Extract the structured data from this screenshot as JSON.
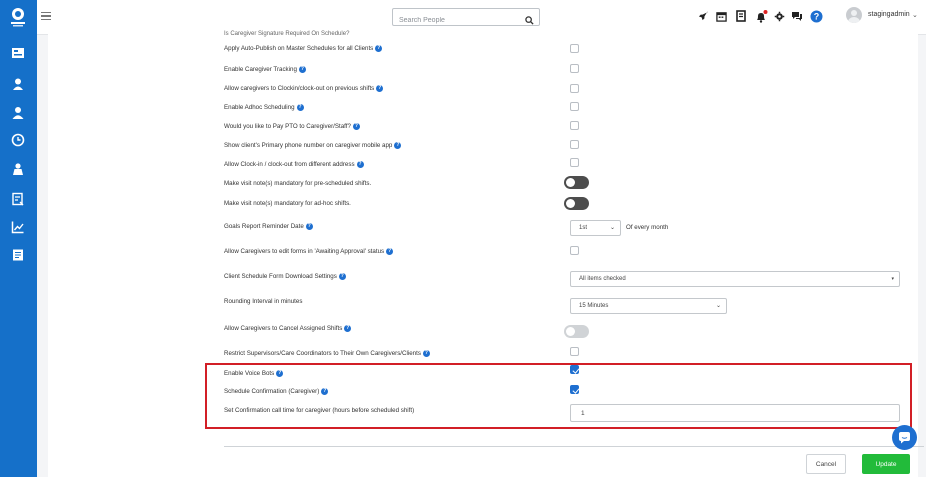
{
  "topbar": {
    "search_placeholder": "Search People",
    "username": "stagingadmin"
  },
  "colors": {
    "sidebar": "#1570c9",
    "accent": "#1e6fd0",
    "highlight_border": "#d21f26",
    "update_button": "#22bb3a"
  },
  "sidebar_icons": [
    "dashboard-icon",
    "client-icon",
    "caregiver-icon",
    "clock-icon",
    "agency-icon",
    "forms-icon",
    "reports-chart-icon",
    "billing-icon"
  ],
  "settings": {
    "clipped_top": "Is Caregiver Signature Required On Schedule?",
    "r1": "Apply Auto-Publish on Master Schedules for all Clients",
    "r2": "Enable Caregiver Tracking",
    "r3": "Allow caregivers to Clockin/clock-out on previous shifts",
    "r4": "Enable Adhoc Scheduling",
    "r5": "Would you like to Pay PTO to Caregiver/Staff?",
    "r6": "Show client's Primary phone number on caregiver mobile app",
    "r7": "Allow Clock-in / clock-out from different address",
    "r8": "Make visit note(s) mandatory for pre-scheduled shifts.",
    "r9": "Make visit note(s) mandatory for ad-hoc shifts.",
    "r10": "Goals Report Reminder Date",
    "r10_select": "1st",
    "r10_suffix": "Of every month",
    "r11": "Allow Caregivers to edit forms in 'Awaiting Approval' status",
    "r12": "Client Schedule Form Download Settings",
    "r12_select": "All items checked",
    "r13": "Rounding Interval in minutes",
    "r13_select": "15 Minutes",
    "r14": "Allow Caregivers to Cancel Assigned Shifts",
    "r15": "Restrict Supervisors/Care Coordinators to Their Own Caregivers/Clients",
    "r16": "Enable Voice Bots",
    "r17": "Schedule Confirmation (Caregiver)",
    "r18": "Set Confirmation call time for caregiver (hours before scheduled shift)",
    "r18_value": "1"
  },
  "footer": {
    "cancel": "Cancel",
    "update": "Update"
  }
}
